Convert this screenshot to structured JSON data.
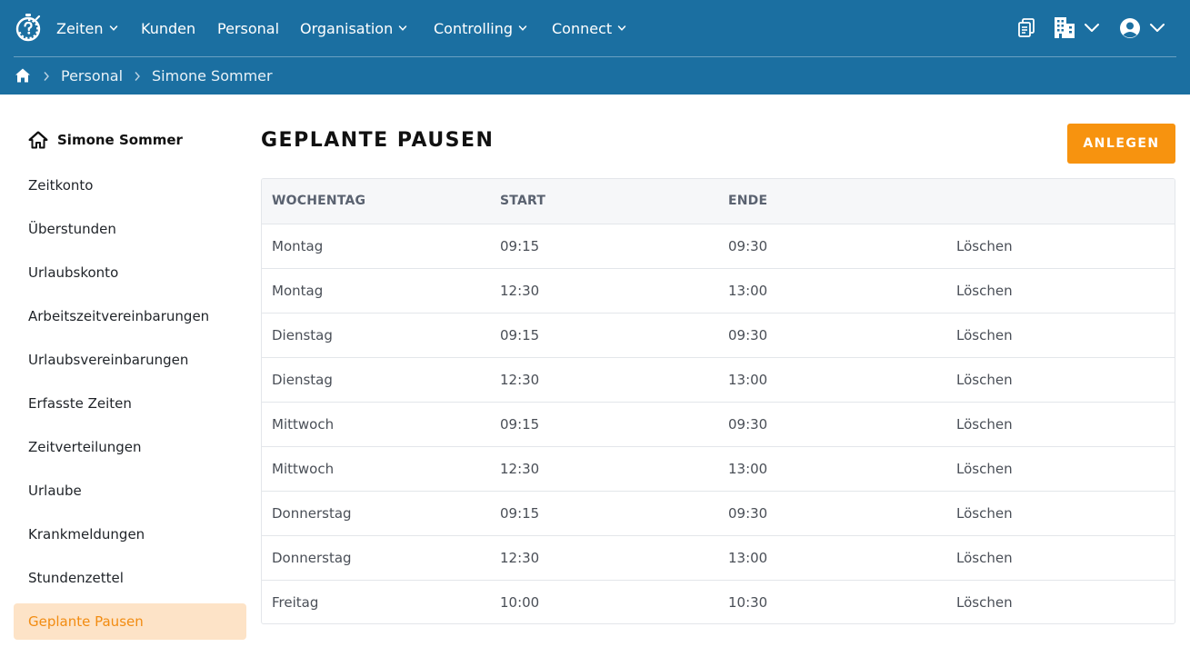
{
  "nav": {
    "items": [
      {
        "label": "Zeiten",
        "has_dropdown": true
      },
      {
        "label": "Kunden",
        "has_dropdown": false
      },
      {
        "label": "Personal",
        "has_dropdown": false
      },
      {
        "label": "Organisation",
        "has_dropdown": true
      },
      {
        "label": "Controlling",
        "has_dropdown": true
      },
      {
        "label": "Connect",
        "has_dropdown": true
      }
    ],
    "icons": [
      "logo-stopwatch-icon",
      "documents-icon",
      "building-icon",
      "user-account-icon"
    ]
  },
  "breadcrumb": {
    "items": [
      "Personal",
      "Simone Sommer"
    ]
  },
  "sidebar": {
    "title": "Simone Sommer",
    "items": [
      {
        "label": "Zeitkonto",
        "active": false
      },
      {
        "label": "Überstunden",
        "active": false
      },
      {
        "label": "Urlaubskonto",
        "active": false
      },
      {
        "label": "Arbeitszeitvereinbarungen",
        "active": false
      },
      {
        "label": "Urlaubsvereinbarungen",
        "active": false
      },
      {
        "label": "Erfasste Zeiten",
        "active": false
      },
      {
        "label": "Zeitverteilungen",
        "active": false
      },
      {
        "label": "Urlaube",
        "active": false
      },
      {
        "label": "Krankmeldungen",
        "active": false
      },
      {
        "label": "Stundenzettel",
        "active": false
      },
      {
        "label": "Geplante Pausen",
        "active": true
      }
    ]
  },
  "main": {
    "title": "GEPLANTE PAUSEN",
    "create_label": "ANLEGEN",
    "columns": [
      "WOCHENTAG",
      "START",
      "ENDE",
      ""
    ],
    "rows": [
      {
        "day": "Montag",
        "start": "09:15",
        "end": "09:30",
        "action": "Löschen"
      },
      {
        "day": "Montag",
        "start": "12:30",
        "end": "13:00",
        "action": "Löschen"
      },
      {
        "day": "Dienstag",
        "start": "09:15",
        "end": "09:30",
        "action": "Löschen"
      },
      {
        "day": "Dienstag",
        "start": "12:30",
        "end": "13:00",
        "action": "Löschen"
      },
      {
        "day": "Mittwoch",
        "start": "09:15",
        "end": "09:30",
        "action": "Löschen"
      },
      {
        "day": "Mittwoch",
        "start": "12:30",
        "end": "13:00",
        "action": "Löschen"
      },
      {
        "day": "Donnerstag",
        "start": "09:15",
        "end": "09:30",
        "action": "Löschen"
      },
      {
        "day": "Donnerstag",
        "start": "12:30",
        "end": "13:00",
        "action": "Löschen"
      },
      {
        "day": "Freitag",
        "start": "10:00",
        "end": "10:30",
        "action": "Löschen"
      }
    ]
  },
  "colors": {
    "header_bg": "#1b6fa1",
    "accent": "#f7930f",
    "active_bg": "#fde3c7",
    "active_text": "#f28c12"
  }
}
